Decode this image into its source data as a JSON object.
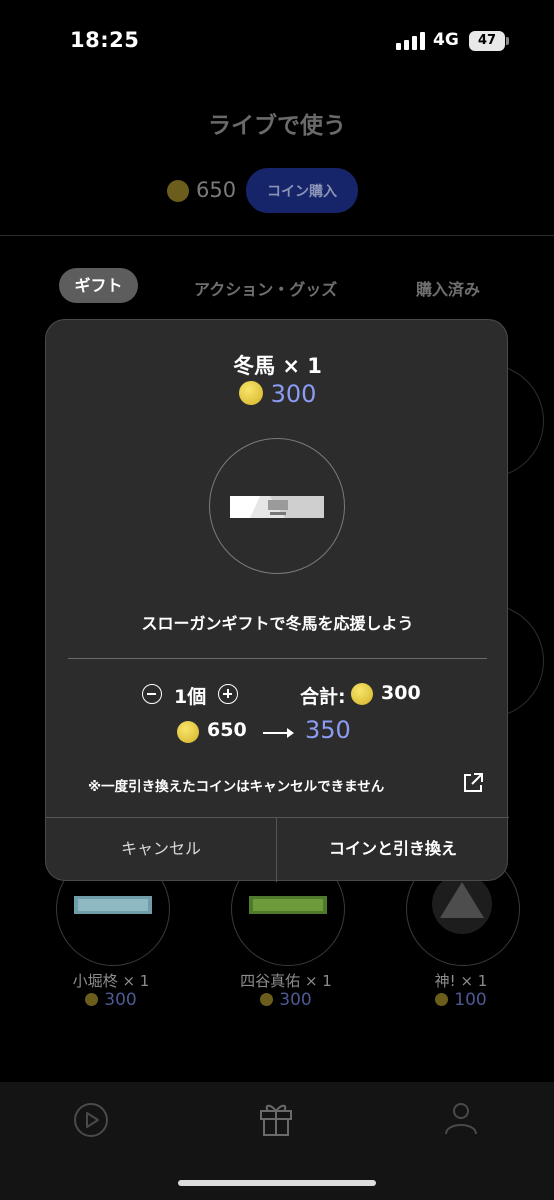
{
  "status_bar": {
    "time": "18:25",
    "network": "4G",
    "battery": "47"
  },
  "page": {
    "title": "ライブで使う",
    "balance": "650",
    "buy_button": "コイン購入",
    "tabs": [
      "ギフト",
      "アクション・グッズ",
      "購入済み"
    ]
  },
  "items": [
    {
      "name": "小堀柊 × 1",
      "price": "300"
    },
    {
      "name": "四谷真佑 × 1",
      "price": "300"
    },
    {
      "name": "神! × 1",
      "price": "100"
    }
  ],
  "modal": {
    "title": "冬馬 × 1",
    "price": "300",
    "description": "スローガンギフトで冬馬を応援しよう",
    "quantity": "1個",
    "total_label": "合計:",
    "total_value": "300",
    "balance_before": "650",
    "balance_after": "350",
    "notice": "※一度引き換えたコインはキャンセルできません",
    "cancel_label": "キャンセル",
    "confirm_label": "コインと引き換え"
  },
  "colors": {
    "accent_price": "#8b9cf2",
    "coin": "#f0d54a",
    "buy_button_bg": "#16256a"
  }
}
